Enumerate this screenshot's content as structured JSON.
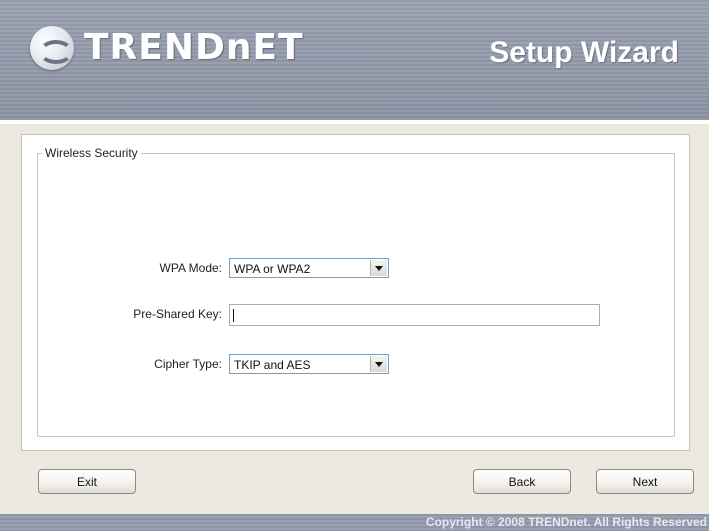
{
  "header": {
    "brand": "TRENDnET",
    "title": "Setup Wizard"
  },
  "group": {
    "legend": "Wireless Security"
  },
  "form": {
    "wpa_mode_label": "WPA Mode:",
    "wpa_mode_value": "WPA or WPA2",
    "psk_label": "Pre-Shared Key:",
    "psk_value": "",
    "cipher_label": "Cipher Type:",
    "cipher_value": "TKIP and AES"
  },
  "buttons": {
    "exit": "Exit",
    "back": "Back",
    "next": "Next"
  },
  "footer": {
    "copyright": "Copyright © 2008 TRENDnet. All Rights Reserved"
  }
}
